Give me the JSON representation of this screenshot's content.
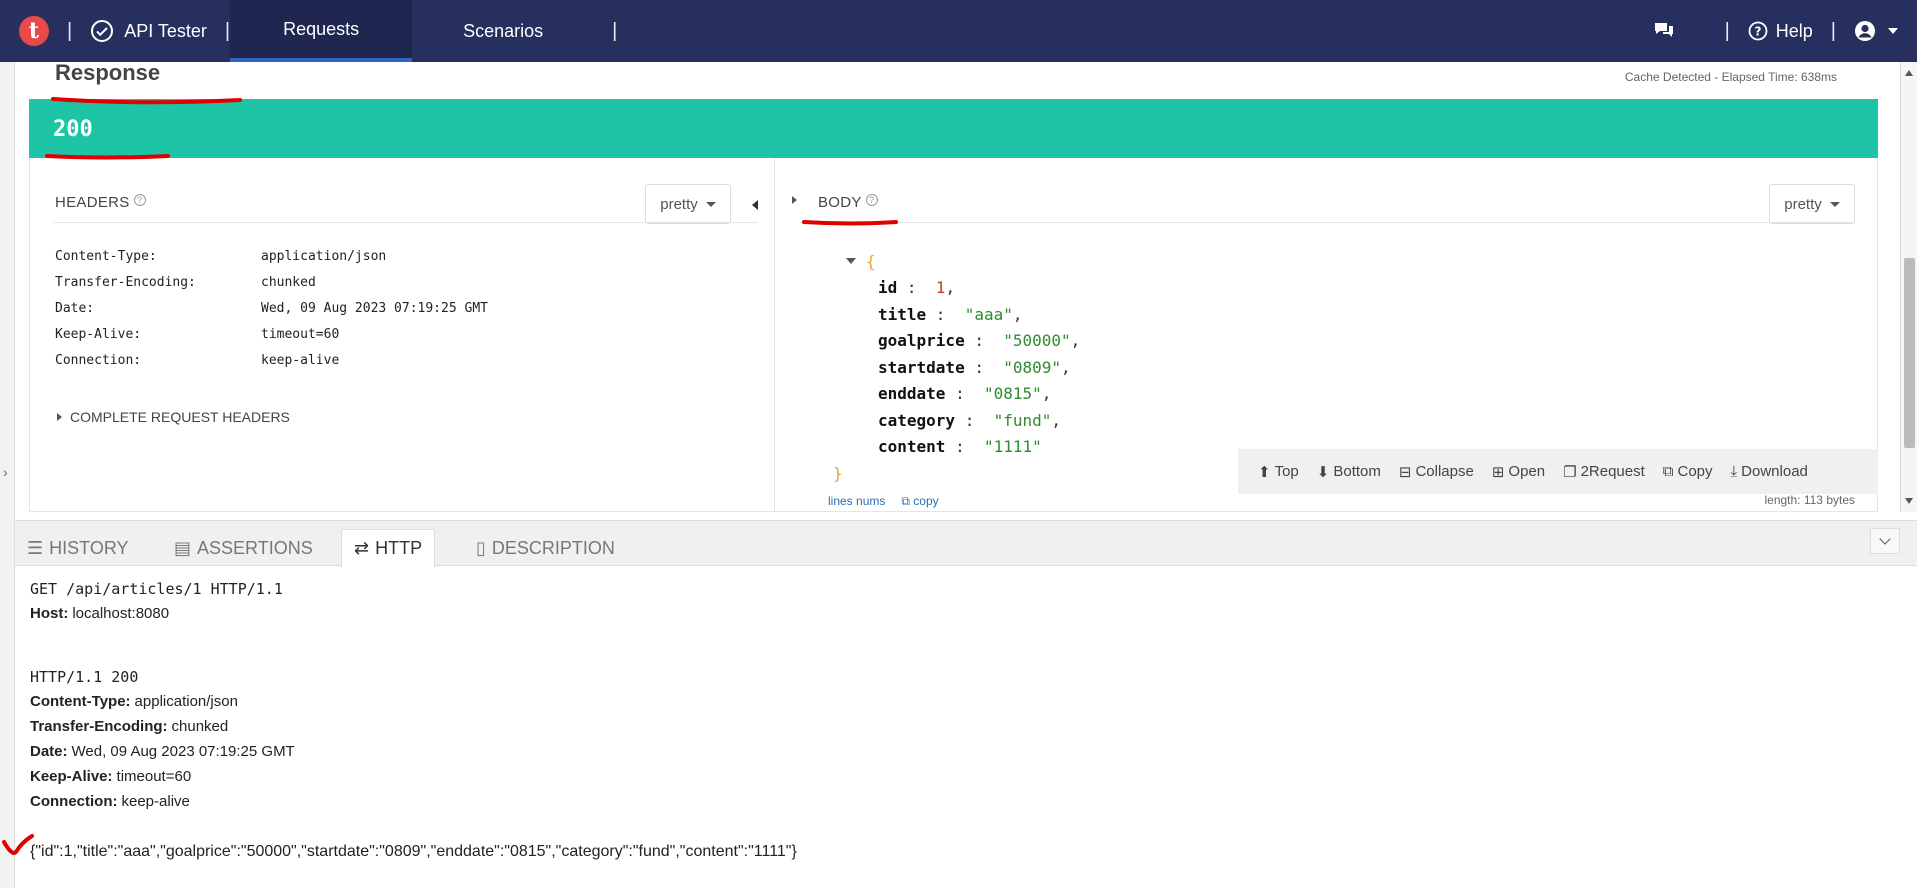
{
  "nav": {
    "logo_letter": "t",
    "brand": "API Tester",
    "tabs": [
      {
        "label": "Requests"
      },
      {
        "label": "Scenarios"
      }
    ],
    "help": "Help"
  },
  "response": {
    "title": "Response",
    "cache_info": "Cache Detected - Elapsed Time: 638ms",
    "status_code": "200",
    "headers_label": "HEADERS",
    "headers_format": "pretty",
    "headers": [
      {
        "key": "Content-Type:",
        "value": "application/json"
      },
      {
        "key": "Transfer-Encoding:",
        "value": "chunked"
      },
      {
        "key": "Date:",
        "value": "Wed, 09 Aug 2023 07:19:25 GMT"
      },
      {
        "key": "Keep-Alive:",
        "value": "timeout=60"
      },
      {
        "key": "Connection:",
        "value": "keep-alive"
      }
    ],
    "complete_request_headers": "COMPLETE REQUEST HEADERS",
    "body_label": "BODY",
    "body_format": "pretty",
    "body": {
      "open_brace": "{",
      "close_brace": "}",
      "fields": [
        {
          "key": "id",
          "value": "1",
          "type": "number"
        },
        {
          "key": "title",
          "value": "\"aaa\"",
          "type": "string"
        },
        {
          "key": "goalprice",
          "value": "\"50000\"",
          "type": "string"
        },
        {
          "key": "startdate",
          "value": "\"0809\"",
          "type": "string"
        },
        {
          "key": "enddate",
          "value": "\"0815\"",
          "type": "string"
        },
        {
          "key": "category",
          "value": "\"fund\"",
          "type": "string"
        },
        {
          "key": "content",
          "value": "\"1111\"",
          "type": "string"
        }
      ]
    },
    "toolbar": {
      "top": "Top",
      "bottom": "Bottom",
      "collapse": "Collapse",
      "open": "Open",
      "to_request": "2Request",
      "copy": "Copy",
      "download": "Download"
    },
    "lines_nums": "lines nums",
    "copy_link": "copy",
    "length": "length: 113 bytes"
  },
  "bottom_tabs": [
    {
      "label": "HISTORY"
    },
    {
      "label": "ASSERTIONS"
    },
    {
      "label": "HTTP"
    },
    {
      "label": "DESCRIPTION"
    }
  ],
  "http": {
    "request_line": "GET /api/articles/1 HTTP/1.1",
    "request_headers": [
      {
        "key": "Host:",
        "value": "localhost:8080"
      }
    ],
    "status_line": "HTTP/1.1 200",
    "response_headers": [
      {
        "key": "Content-Type:",
        "value": "application/json"
      },
      {
        "key": "Transfer-Encoding:",
        "value": "chunked"
      },
      {
        "key": "Date:",
        "value": "Wed, 09 Aug 2023 07:19:25 GMT"
      },
      {
        "key": "Keep-Alive:",
        "value": "timeout=60"
      },
      {
        "key": "Connection:",
        "value": "keep-alive"
      }
    ],
    "raw_body": "{\"id\":1,\"title\":\"aaa\",\"goalprice\":\"50000\",\"startdate\":\"0809\",\"enddate\":\"0815\",\"category\":\"fund\",\"content\":\"1111\"}"
  },
  "colors": {
    "navbar": "#272f5e",
    "status_ok": "#1ec4a6",
    "annotation": "#e00000"
  }
}
